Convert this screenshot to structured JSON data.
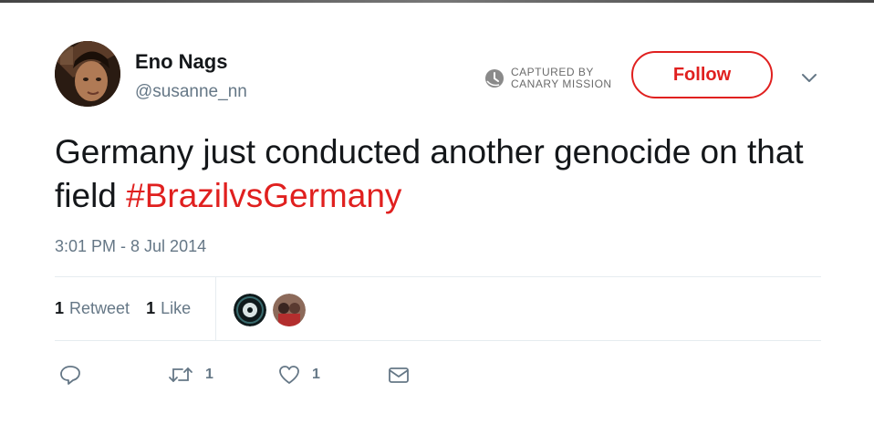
{
  "user": {
    "name": "Eno Nags",
    "handle": "@susanne_nn"
  },
  "stamp": {
    "line1": "CAPTURED BY",
    "line2": "CANARY MISSION",
    "icon": "clock-icon"
  },
  "follow_label": "Follow",
  "tweet": {
    "text": "Germany just conducted another genocide on that field ",
    "hashtag": "#BrazilvsGermany",
    "timestamp": "3:01 PM - 8 Jul 2014"
  },
  "stats": {
    "retweet_count": "1",
    "retweet_label": "Retweet",
    "like_count": "1",
    "like_label": "Like"
  },
  "actions": {
    "reply_icon": "reply-icon",
    "retweet_icon": "retweet-icon",
    "retweet_count": "1",
    "like_icon": "heart-icon",
    "like_count": "1",
    "message_icon": "envelope-icon"
  },
  "colors": {
    "accent": "#e0201f",
    "secondary_text": "#657786",
    "primary_text": "#14171a"
  }
}
